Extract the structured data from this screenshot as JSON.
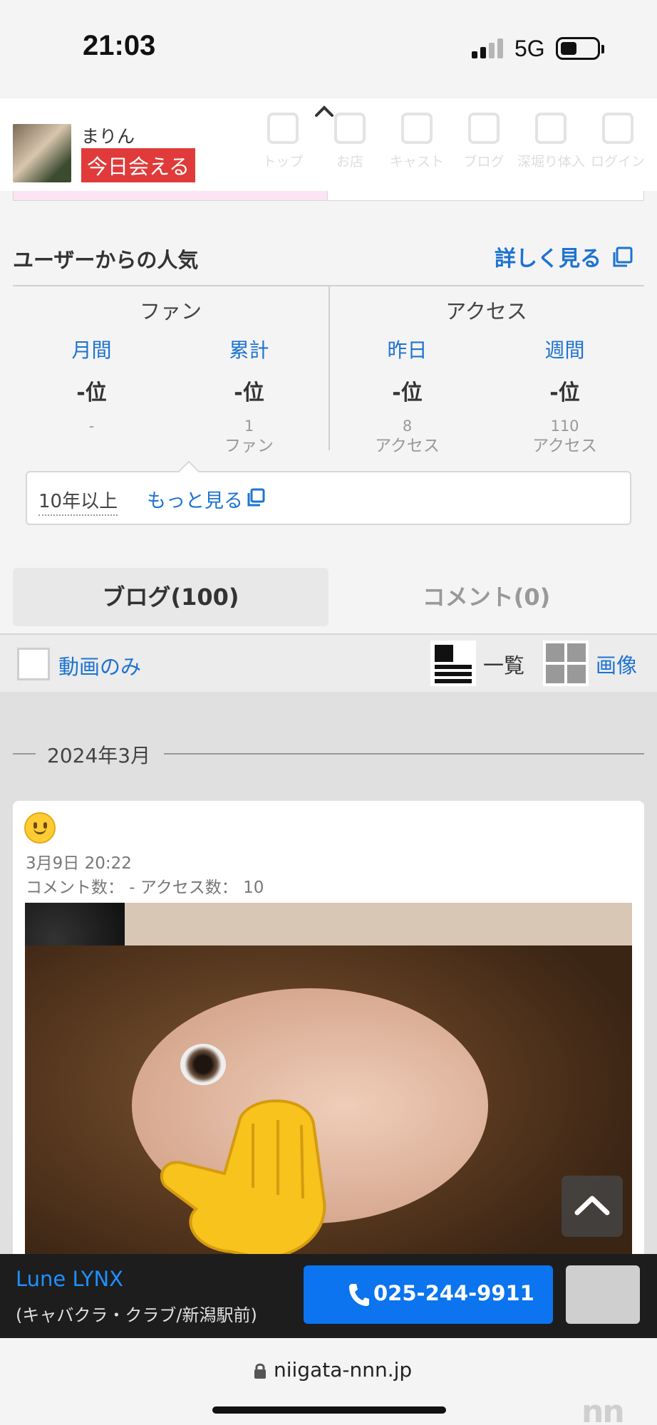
{
  "status_bar": {
    "time": "21:03",
    "network": "5G"
  },
  "header": {
    "profile_name": "まりん",
    "today_badge": "今日会える",
    "nav": [
      "トップ",
      "お店",
      "キャスト",
      "ブログ",
      "深堀り体入",
      "ログイン"
    ]
  },
  "popularity": {
    "title": "ユーザーからの人気",
    "more_link": "詳しく見る",
    "fan": {
      "label": "ファン",
      "monthly": {
        "label": "月間",
        "rank": "-位",
        "count": "-",
        "unit": ""
      },
      "total": {
        "label": "累計",
        "rank": "-位",
        "count": "1",
        "unit": "ファン"
      }
    },
    "access": {
      "label": "アクセス",
      "yesterday": {
        "label": "昨日",
        "rank": "-位",
        "count": "8",
        "unit": "アクセス"
      },
      "weekly": {
        "label": "週間",
        "rank": "-位",
        "count": "110",
        "unit": "アクセス"
      }
    },
    "tenure": {
      "text": "10年以上",
      "more": "もっと見る"
    }
  },
  "tabs": {
    "blog": "ブログ(100)",
    "comment": "コメント(0)"
  },
  "filters": {
    "video_only": "動画のみ",
    "list_view": "一覧",
    "image_view": "画像"
  },
  "feed": {
    "month_label": "2024年3月",
    "post": {
      "date": "3月9日 20:22",
      "stats": "コメント数： - アクセス数： 10",
      "emoji_icon": "slightly-smiling-face-icon"
    }
  },
  "shop_bar": {
    "name": "Lune LYNX",
    "subtitle": "(キャバクラ・クラブ/新潟駅前)",
    "phone": "025-244-9911"
  },
  "url_bar": {
    "domain": "niigata-nnn.jp"
  },
  "watermark": "nn",
  "colors": {
    "link_blue": "#1e73d2",
    "call_blue": "#0b74ee",
    "badge_red": "#e03a3a"
  }
}
